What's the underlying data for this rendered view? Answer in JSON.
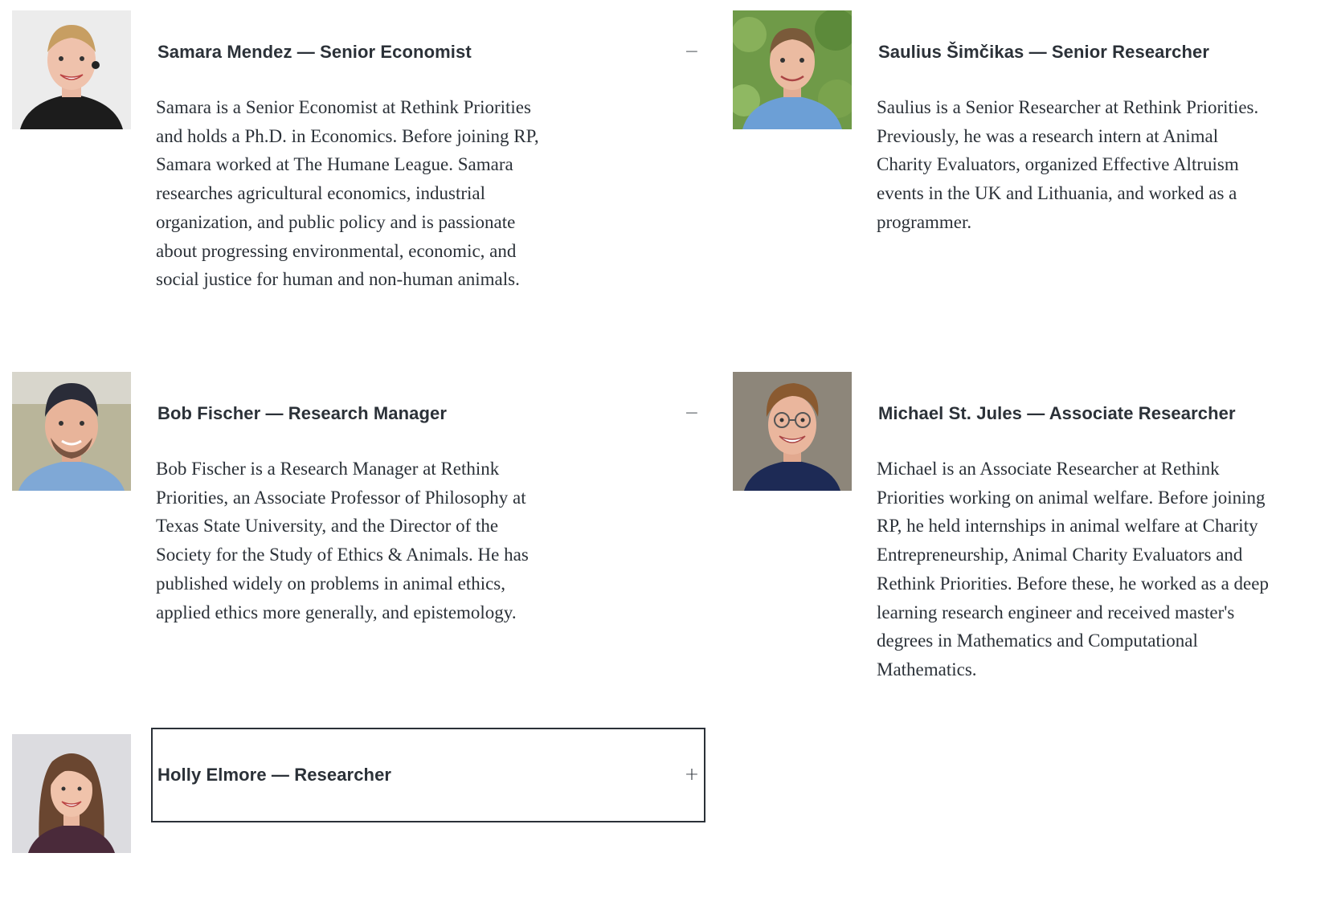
{
  "members": [
    {
      "name": "Samara Mendez — Senior Economist",
      "toggle": "−",
      "expanded": true,
      "bio": "Samara is a Senior Economist at Rethink Priorities and holds a Ph.D. in Economics. Before joining RP, Samara worked at The Humane League. Samara researches agricultural economics, industrial organization, and public policy and is passionate about progressing environmental, economic, and social justice for human and non-human animals."
    },
    {
      "name": "Saulius Šimčikas — Senior Researcher",
      "toggle": "",
      "expanded": true,
      "bio": "Saulius is a Senior Researcher at Rethink Priorities. Previously, he was a research intern at Animal Charity Evaluators, organized Effective Altruism events in the UK and Lithuania, and worked as a programmer."
    },
    {
      "name": "Bob Fischer — Research Manager",
      "toggle": "−",
      "expanded": true,
      "bio": "Bob Fischer is a Research Manager at Rethink Priorities, an Associate Professor of Philosophy at Texas State University, and the Director of the Society for the Study of Ethics & Animals. He has published widely on problems in animal ethics, applied ethics more generally, and epistemology."
    },
    {
      "name": "Michael St. Jules — Associate Researcher",
      "toggle": "",
      "expanded": true,
      "bio": "Michael is an Associate Researcher at Rethink Priorities working on animal welfare. Before joining RP, he held internships in animal welfare at Charity Entrepreneurship, Animal Charity Evaluators and Rethink Priorities. Before these, he worked as a deep learning research engineer and received master's degrees in Mathematics and Computational Mathematics."
    },
    {
      "name": "Holly Elmore — Researcher",
      "toggle": "+",
      "expanded": false,
      "bio": ""
    }
  ]
}
